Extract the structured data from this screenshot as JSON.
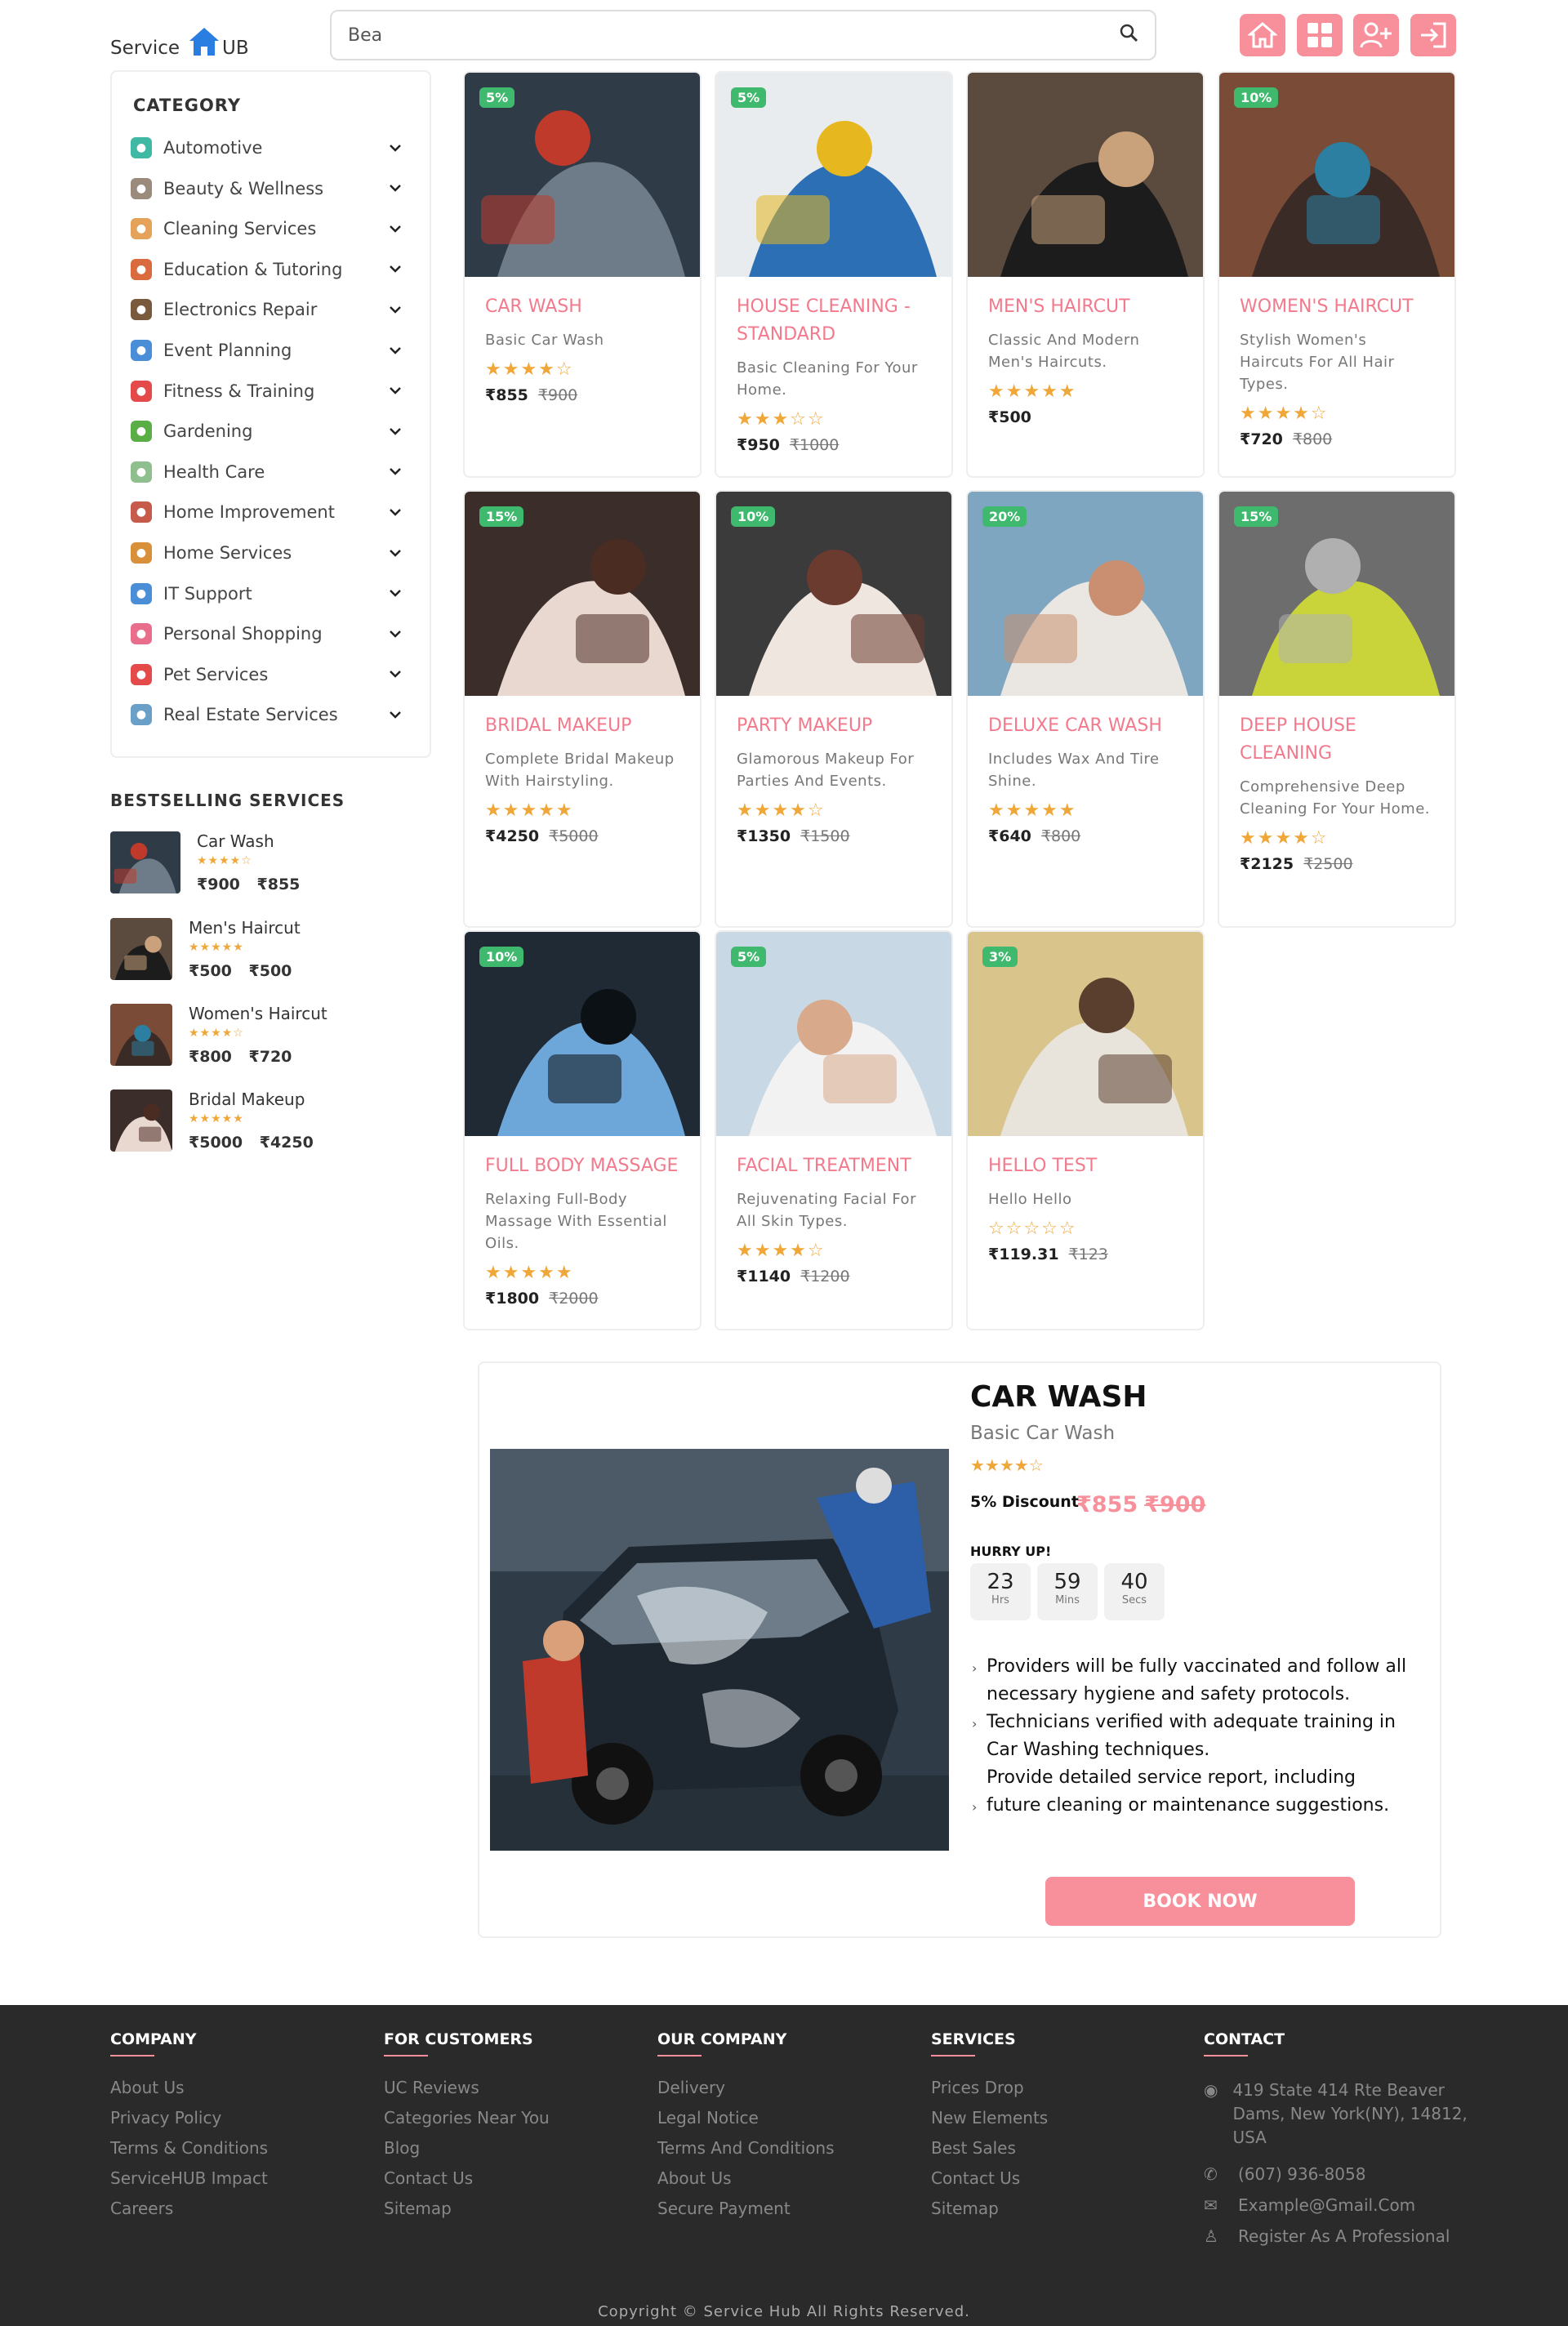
{
  "header": {
    "logo_pre": "Service",
    "logo_post": "UB",
    "search_value": "Bea",
    "buttons": [
      "home-icon",
      "grid-icon",
      "add-user-icon",
      "login-icon"
    ]
  },
  "sidebar": {
    "category_title": "CATEGORY",
    "categories": [
      {
        "label": "Automotive",
        "icon": "car-icon",
        "color": "#3fb9a3"
      },
      {
        "label": "Beauty & Wellness",
        "icon": "beauty-icon",
        "color": "#9a8b7c"
      },
      {
        "label": "Cleaning Services",
        "icon": "cleaning-icon",
        "color": "#e4a25b"
      },
      {
        "label": "Education & Tutoring",
        "icon": "books-icon",
        "color": "#d96b3e"
      },
      {
        "label": "Electronics Repair",
        "icon": "electronics-icon",
        "color": "#7a5a3d"
      },
      {
        "label": "Event Planning",
        "icon": "event-icon",
        "color": "#4a8ed8"
      },
      {
        "label": "Fitness & Training",
        "icon": "heart-icon",
        "color": "#e44a4a"
      },
      {
        "label": "Gardening",
        "icon": "plant-icon",
        "color": "#5aae45"
      },
      {
        "label": "Health Care",
        "icon": "health-icon",
        "color": "#8fbf8f"
      },
      {
        "label": "Home Improvement",
        "icon": "home-improvement-icon",
        "color": "#c75b4b"
      },
      {
        "label": "Home Services",
        "icon": "house-icon",
        "color": "#d8903a"
      },
      {
        "label": "IT Support",
        "icon": "laptop-icon",
        "color": "#4a8ed8"
      },
      {
        "label": "Personal Shopping",
        "icon": "shopping-icon",
        "color": "#e96e8c"
      },
      {
        "label": "Pet Services",
        "icon": "pet-icon",
        "color": "#e44a4a"
      },
      {
        "label": "Real Estate Services",
        "icon": "real-estate-icon",
        "color": "#6aa0c8"
      }
    ],
    "bestselling_title": "BESTSELLING SERVICES",
    "bestselling": [
      {
        "name": "Car Wash",
        "stars": "★★★★☆",
        "old": "₹900",
        "new": "₹855"
      },
      {
        "name": "Men's Haircut",
        "stars": "★★★★★",
        "old": "₹500",
        "new": "₹500"
      },
      {
        "name": "Women's Haircut",
        "stars": "★★★★☆",
        "old": "₹800",
        "new": "₹720"
      },
      {
        "name": "Bridal Makeup",
        "stars": "★★★★★",
        "old": "₹5000",
        "new": "₹4250"
      }
    ]
  },
  "services": [
    {
      "title": "CAR WASH",
      "desc": "Basic Car Wash",
      "badge": "5%",
      "stars": "★★★★☆",
      "price": "₹855",
      "old": "₹900"
    },
    {
      "title": "HOUSE CLEANING - STANDARD",
      "desc": "Basic Cleaning For Your Home.",
      "badge": "5%",
      "stars": "★★★☆☆",
      "price": "₹950",
      "old": "₹1000"
    },
    {
      "title": "MEN'S HAIRCUT",
      "desc": "Classic And Modern Men's Haircuts.",
      "badge": "",
      "stars": "★★★★★",
      "price": "₹500",
      "old": ""
    },
    {
      "title": "WOMEN'S HAIRCUT",
      "desc": "Stylish Women's Haircuts For All Hair Types.",
      "badge": "10%",
      "stars": "★★★★☆",
      "price": "₹720",
      "old": "₹800"
    },
    {
      "title": "BRIDAL MAKEUP",
      "desc": "Complete Bridal Makeup With Hairstyling.",
      "badge": "15%",
      "stars": "★★★★★",
      "price": "₹4250",
      "old": "₹5000"
    },
    {
      "title": "PARTY MAKEUP",
      "desc": "Glamorous Makeup For Parties And Events.",
      "badge": "10%",
      "stars": "★★★★☆",
      "price": "₹1350",
      "old": "₹1500"
    },
    {
      "title": "DELUXE CAR WASH",
      "desc": "Includes Wax And Tire Shine.",
      "badge": "20%",
      "stars": "★★★★★",
      "price": "₹640",
      "old": "₹800"
    },
    {
      "title": "DEEP HOUSE CLEANING",
      "desc": "Comprehensive Deep Cleaning For Your Home.",
      "badge": "15%",
      "stars": "★★★★☆",
      "price": "₹2125",
      "old": "₹2500"
    },
    {
      "title": "FULL BODY MASSAGE",
      "desc": "Relaxing Full-Body Massage With Essential Oils.",
      "badge": "10%",
      "stars": "★★★★★",
      "price": "₹1800",
      "old": "₹2000"
    },
    {
      "title": "FACIAL TREATMENT",
      "desc": "Rejuvenating Facial For All Skin Types.",
      "badge": "5%",
      "stars": "★★★★☆",
      "price": "₹1140",
      "old": "₹1200"
    },
    {
      "title": "HELLO TEST",
      "desc": "Hello Hello",
      "badge": "3%",
      "stars": "☆☆☆☆☆",
      "price": "₹119.31",
      "old": "₹123"
    }
  ],
  "detail": {
    "title": "CAR WASH",
    "subtitle": "Basic Car Wash",
    "stars": "★★★★☆",
    "discount": "5% Discount",
    "price": "₹855",
    "old_price": "₹900",
    "hurry": "HURRY UP!",
    "timer": [
      {
        "n": "23",
        "u": "Hrs"
      },
      {
        "n": "59",
        "u": "Mins"
      },
      {
        "n": "40",
        "u": "Secs"
      }
    ],
    "features": [
      "Providers will be fully vaccinated and follow all necessary hygiene and safety protocols.",
      "Technicians verified with adequate training in Car Washing techniques.",
      "Provide detailed service report, including future cleaning or maintenance suggestions."
    ],
    "book_label": "BOOK NOW"
  },
  "footer": {
    "company": {
      "title": "COMPANY",
      "links": [
        "About Us",
        "Privacy Policy",
        "Terms & Conditions",
        "ServiceHUB Impact",
        "Careers"
      ]
    },
    "customers": {
      "title": "FOR CUSTOMERS",
      "links": [
        "UC Reviews",
        "Categories Near You",
        "Blog",
        "Contact Us",
        "Sitemap"
      ]
    },
    "ourcompany": {
      "title": "OUR COMPANY",
      "links": [
        "Delivery",
        "Legal Notice",
        "Terms And Conditions",
        "About Us",
        "Secure Payment"
      ]
    },
    "services": {
      "title": "SERVICES",
      "links": [
        "Prices Drop",
        "New Elements",
        "Best Sales",
        "Contact Us",
        "Sitemap"
      ]
    },
    "contact": {
      "title": "CONTACT",
      "address": "419 State 414 Rte Beaver Dams, New York(NY), 14812, USA",
      "phone": "(607) 936-8058",
      "email": "Example@Gmail.Com",
      "register": "Register As A Professional"
    },
    "copyright": "Copyright © Service Hub All Rights Reserved."
  },
  "colors": {
    "accent": "#f8909b",
    "title": "#f27a8c",
    "badge": "#3fb96d",
    "star": "#f0a73a",
    "footer": "#2b2a2b"
  }
}
